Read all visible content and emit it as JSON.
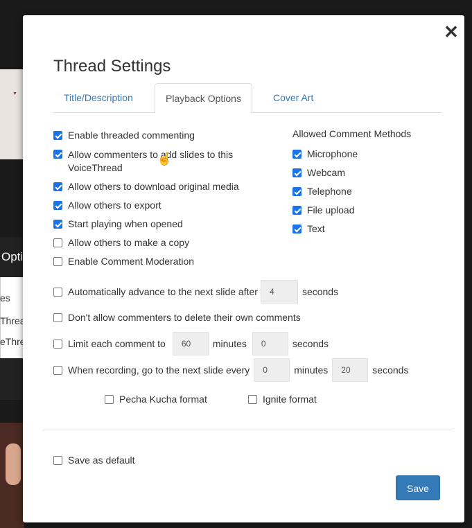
{
  "background": {
    "menu_header": "Options",
    "menu_items": [
      "es",
      "Thread",
      "eThread"
    ]
  },
  "modal": {
    "title": "Thread Settings",
    "close_icon": "close-icon",
    "tabs": [
      {
        "label": "Title/Description",
        "active": false
      },
      {
        "label": "Playback Options",
        "active": true
      },
      {
        "label": "Cover Art",
        "active": false
      }
    ],
    "options": [
      {
        "label": "Enable threaded commenting",
        "checked": true
      },
      {
        "label": "Allow commenters to add slides to this VoiceThread",
        "checked": true
      },
      {
        "label": "Allow others to download original media",
        "checked": true
      },
      {
        "label": "Allow others to export",
        "checked": true
      },
      {
        "label": "Start playing when opened",
        "checked": true
      },
      {
        "label": "Allow others to make a copy",
        "checked": false
      },
      {
        "label": "Enable Comment Moderation",
        "checked": false
      }
    ],
    "comment_methods": {
      "heading": "Allowed Comment Methods",
      "items": [
        {
          "label": "Microphone",
          "checked": true
        },
        {
          "label": "Webcam",
          "checked": true
        },
        {
          "label": "Telephone",
          "checked": true
        },
        {
          "label": "File upload",
          "checked": true
        },
        {
          "label": "Text",
          "checked": true
        }
      ]
    },
    "auto_advance": {
      "label": "Automatically advance to the next slide after",
      "value": "4",
      "unit": "seconds",
      "checked": false
    },
    "no_delete": {
      "label": "Don't allow commenters to delete their own comments",
      "checked": false
    },
    "limit_comment": {
      "label": "Limit each comment to",
      "minutes": "60",
      "minutes_unit": "minutes",
      "seconds": "0",
      "seconds_unit": "seconds",
      "checked": false
    },
    "recording": {
      "label": "When recording, go to the next slide every",
      "minutes": "0",
      "minutes_unit": "minutes",
      "seconds": "20",
      "seconds_unit": "seconds",
      "checked": false
    },
    "formats": [
      {
        "label": "Pecha Kucha format",
        "checked": false
      },
      {
        "label": "Ignite format",
        "checked": false
      }
    ],
    "save_default": {
      "label": "Save as default",
      "checked": false
    },
    "save_button": "Save"
  }
}
